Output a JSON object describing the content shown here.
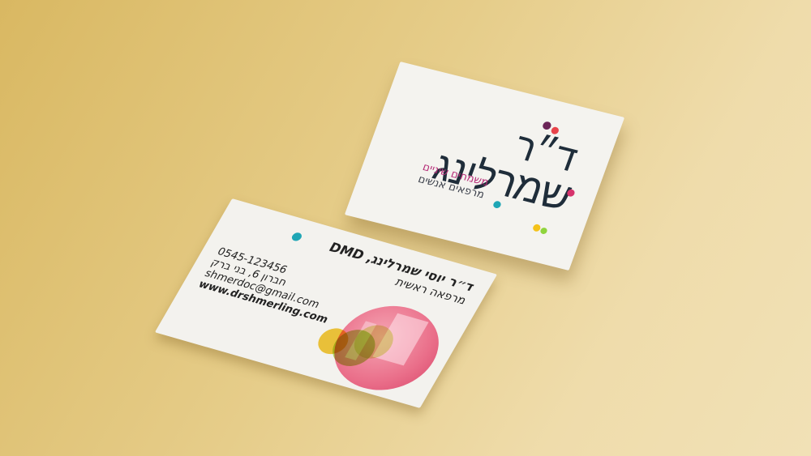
{
  "logo_card": {
    "title_line1": "ד״ר",
    "title_line2": "שמרלינג",
    "tagline_line1": "משמחים שיניים",
    "tagline_line2": "מרפאים אנשים"
  },
  "info_card": {
    "name": "ד״ר יוסי שמרלינג, DMD",
    "role": "מרפאה ראשית",
    "phone": "0545-123456",
    "address": "חברון 6, בני ברק",
    "email": "shmerdoc@gmail.com",
    "website": "www.drshmerling.com"
  },
  "colors": {
    "background": "#e6cd8a",
    "card": "#f4f3ef",
    "text_dark": "#1f2d3a",
    "accent_magenta": "#d6336c",
    "accent_teal": "#1fa6b5",
    "accent_yellow": "#f4c21a",
    "accent_green": "#8fd43c",
    "accent_purple": "#6b2457",
    "accent_red": "#e8434a"
  }
}
